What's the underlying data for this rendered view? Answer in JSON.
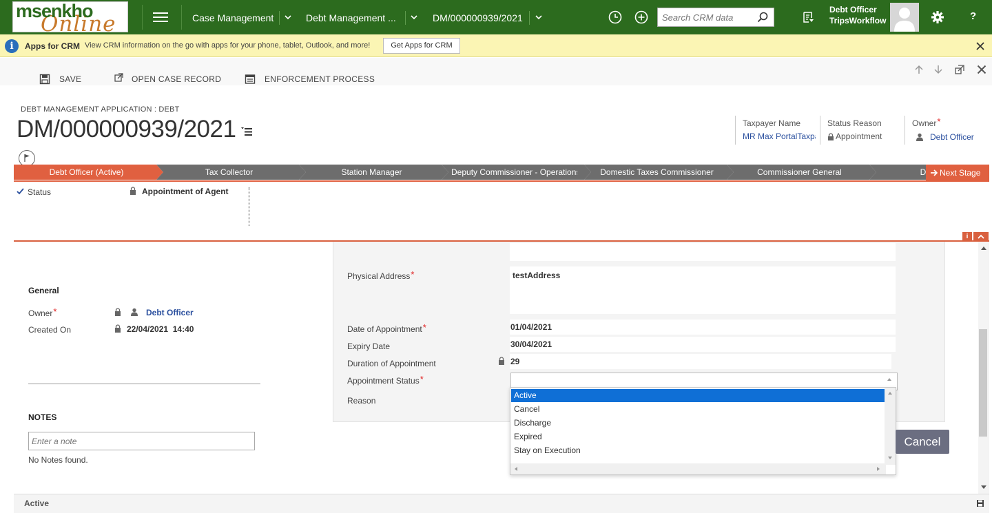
{
  "nav": {
    "logo_line1": "msenkho",
    "logo_line2": "Online",
    "crumb1": "Case Management",
    "crumb2": "Debt Management ...",
    "crumb3": "DM/000000939/2021",
    "search_placeholder": "Search CRM data",
    "user_name": "Debt Officer",
    "user_org": "TripsWorkflow",
    "help": "?"
  },
  "apps_bar": {
    "title": "Apps for CRM",
    "message": "View CRM information on the go with apps for your phone, tablet, Outlook, and more!",
    "button": "Get Apps for CRM"
  },
  "commands": {
    "save": "SAVE",
    "open_case": "OPEN CASE RECORD",
    "enforcement": "ENFORCEMENT PROCESS"
  },
  "header": {
    "entity_type": "DEBT MANAGEMENT APPLICATION : DEBT",
    "title": "DM/000000939/2021",
    "fields": [
      {
        "label": "Taxpayer Name",
        "value": "MR Max PortalTaxpayer"
      },
      {
        "label": "Status Reason",
        "value": "Appointment"
      },
      {
        "label": "Owner",
        "value": "Debt Officer"
      }
    ]
  },
  "process": {
    "stages": [
      {
        "label": "Debt Officer (Active)",
        "active": true
      },
      {
        "label": "Tax Collector",
        "active": false
      },
      {
        "label": "Station Manager",
        "active": false
      },
      {
        "label": "Deputy Commissioner - Operations",
        "active": false
      },
      {
        "label": "Domestic Taxes Commissioner",
        "active": false
      },
      {
        "label": "Commissioner General",
        "active": false
      },
      {
        "label": "Debt Officer",
        "active": false
      }
    ],
    "next_stage": "Next Stage",
    "status_label": "Status",
    "status_value": "Appointment of Agent",
    "flyout_info": "i",
    "colors": {
      "active": "#e06040",
      "inactive": "#6d6d6d"
    }
  },
  "general": {
    "heading": "General",
    "owner_label": "Owner",
    "owner_value": "Debt Officer",
    "created_label": "Created On",
    "created_value": "22/04/2021  14:40"
  },
  "notes": {
    "heading": "NOTES",
    "placeholder": "Enter a note",
    "empty": "No Notes found."
  },
  "form": {
    "physical_address_label": "Physical Address",
    "physical_address_value": "testAddress",
    "date_appointment_label": "Date of Appointment",
    "date_appointment_value": "01/04/2021",
    "expiry_label": "Expiry Date",
    "expiry_value": "30/04/2021",
    "duration_label": "Duration of Appointment",
    "duration_value": "29",
    "status_label": "Appointment Status",
    "reason_label": "Reason",
    "cancel": "Cancel"
  },
  "dropdown": {
    "options": [
      "Active",
      "Cancel",
      "Discharge",
      "Expired",
      "Stay on Execution"
    ],
    "selected": "Active"
  },
  "footer": {
    "status": "Active"
  }
}
